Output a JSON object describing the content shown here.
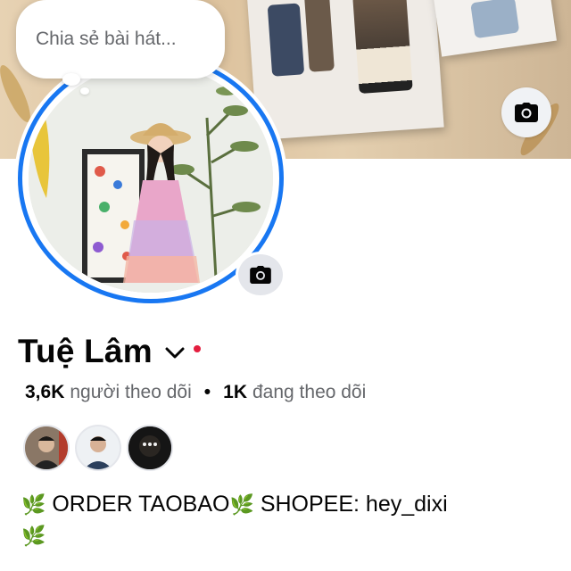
{
  "cover": {
    "camera_icon": "camera-icon"
  },
  "status_bubble": {
    "placeholder": "Chia sẻ bài hát..."
  },
  "avatar": {
    "camera_icon": "camera-icon"
  },
  "profile": {
    "name": "Tuệ Lâm",
    "dropdown_icon": "chevron-down-icon",
    "followers_count": "3,6K",
    "followers_label": "người theo dõi",
    "separator": "•",
    "following_count": "1K",
    "following_label": "đang theo dõi"
  },
  "mutual_followers": [
    {
      "name": "avatar-1"
    },
    {
      "name": "avatar-2"
    },
    {
      "name": "avatar-3"
    }
  ],
  "bio": {
    "text1": "ORDER TAOBAO",
    "text2": "SHOPEE: hey_dixi",
    "emoji": "🌿"
  },
  "colors": {
    "accent": "#1877f2",
    "text": "#050505",
    "secondary": "#65676b",
    "red_dot": "#e41e3f"
  }
}
